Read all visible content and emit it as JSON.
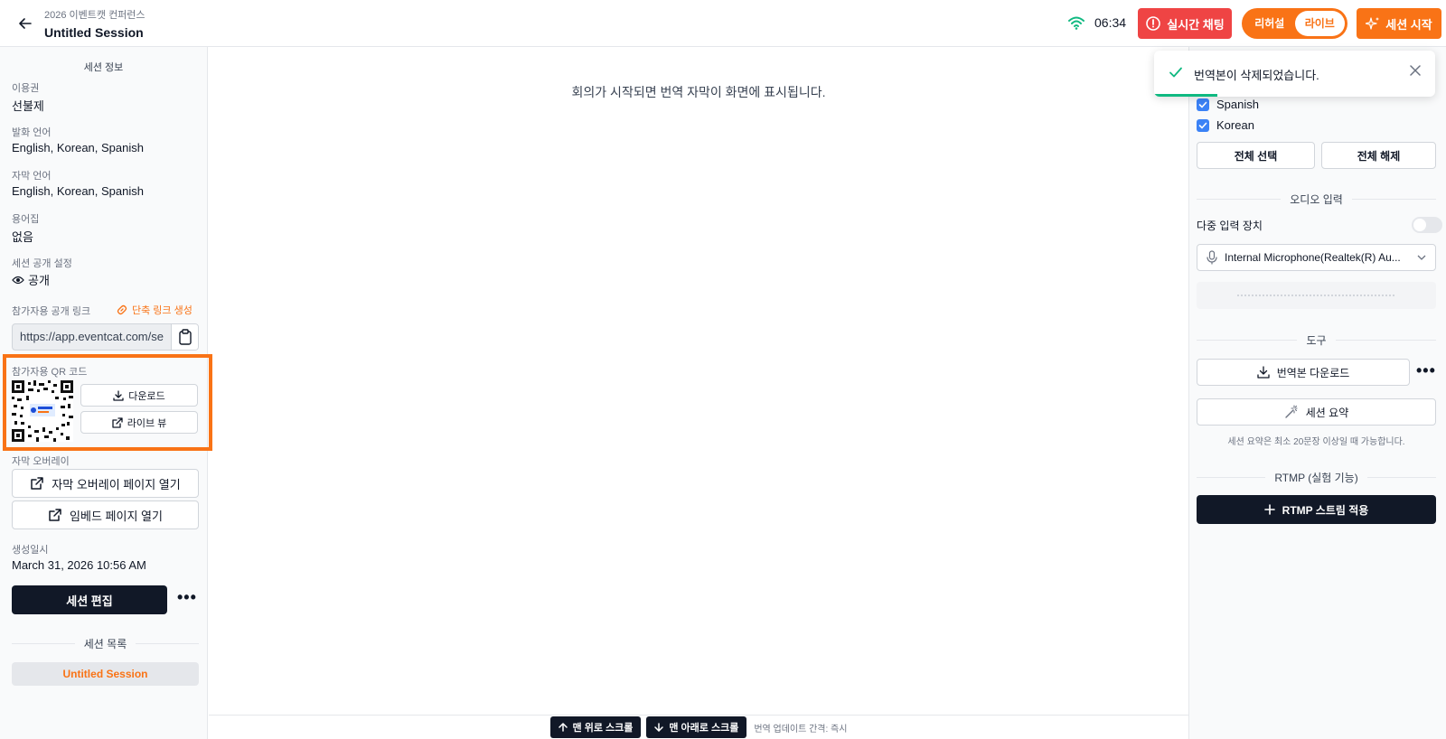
{
  "header": {
    "event_name": "2026 이벤트캣 컨퍼런스",
    "session_title": "Untitled Session",
    "timer": "06:34",
    "chat_button": "실시간 채팅",
    "mode_rehearsal": "리허설",
    "mode_live": "라이브",
    "start_button": "세션 시작"
  },
  "left": {
    "section_title": "세션 정보",
    "plan_label": "이용권",
    "plan_value": "선불제",
    "speech_lang_label": "발화 언어",
    "speech_lang_value": "English, Korean, Spanish",
    "caption_lang_label": "자막 언어",
    "caption_lang_value": "English, Korean, Spanish",
    "glossary_label": "용어집",
    "glossary_value": "없음",
    "visibility_label": "세션 공개 설정",
    "visibility_value": "공개",
    "link_label": "참가자용 공개 링크",
    "short_link": "단축 링크 생성",
    "link_url": "https://app.eventcat.com/se",
    "qr_label": "참가자용 QR 코드",
    "qr_download": "다운로드",
    "qr_liveview": "라이브 뷰",
    "overlay_label": "자막 오버레이",
    "overlay_open": "자막 오버레이 페이지 열기",
    "embed_open": "임베드 페이지 열기",
    "created_label": "생성일시",
    "created_value": "March 31, 2026 10:56 AM",
    "edit_button": "세션 편집",
    "more": "•••",
    "list_title": "세션 목록",
    "session_item": "Untitled Session"
  },
  "center": {
    "placeholder": "회의가 시작되면 번역 자막이 화면에 표시됩니다.",
    "scroll_top": "맨 위로 스크롤",
    "scroll_bottom": "맨 아래로 스크롤",
    "update_interval": "번역 업데이트 간격: 즉시"
  },
  "toast": {
    "message": "번역본이 삭제되었습니다."
  },
  "right": {
    "lang_spanish": "Spanish",
    "lang_korean": "Korean",
    "select_all": "전체 선택",
    "deselect_all": "전체 해제",
    "audio_title": "오디오 입력",
    "multi_input": "다중 입력 장치",
    "mic_device": "Internal Microphone(Realtek(R) Au...",
    "tools_title": "도구",
    "download_translation": "번역본 다운로드",
    "more": "•••",
    "summary": "세션 요약",
    "summary_hint": "세션 요약은 최소 20문장 이상일 때 가능합니다.",
    "rtmp_title": "RTMP (실험 기능)",
    "rtmp_apply": "RTMP 스트림 적용"
  },
  "colors": {
    "accent": "#f97316",
    "danger": "#ef4444",
    "dark": "#111827",
    "checkbox": "#3b82f6",
    "success": "#10b981"
  }
}
